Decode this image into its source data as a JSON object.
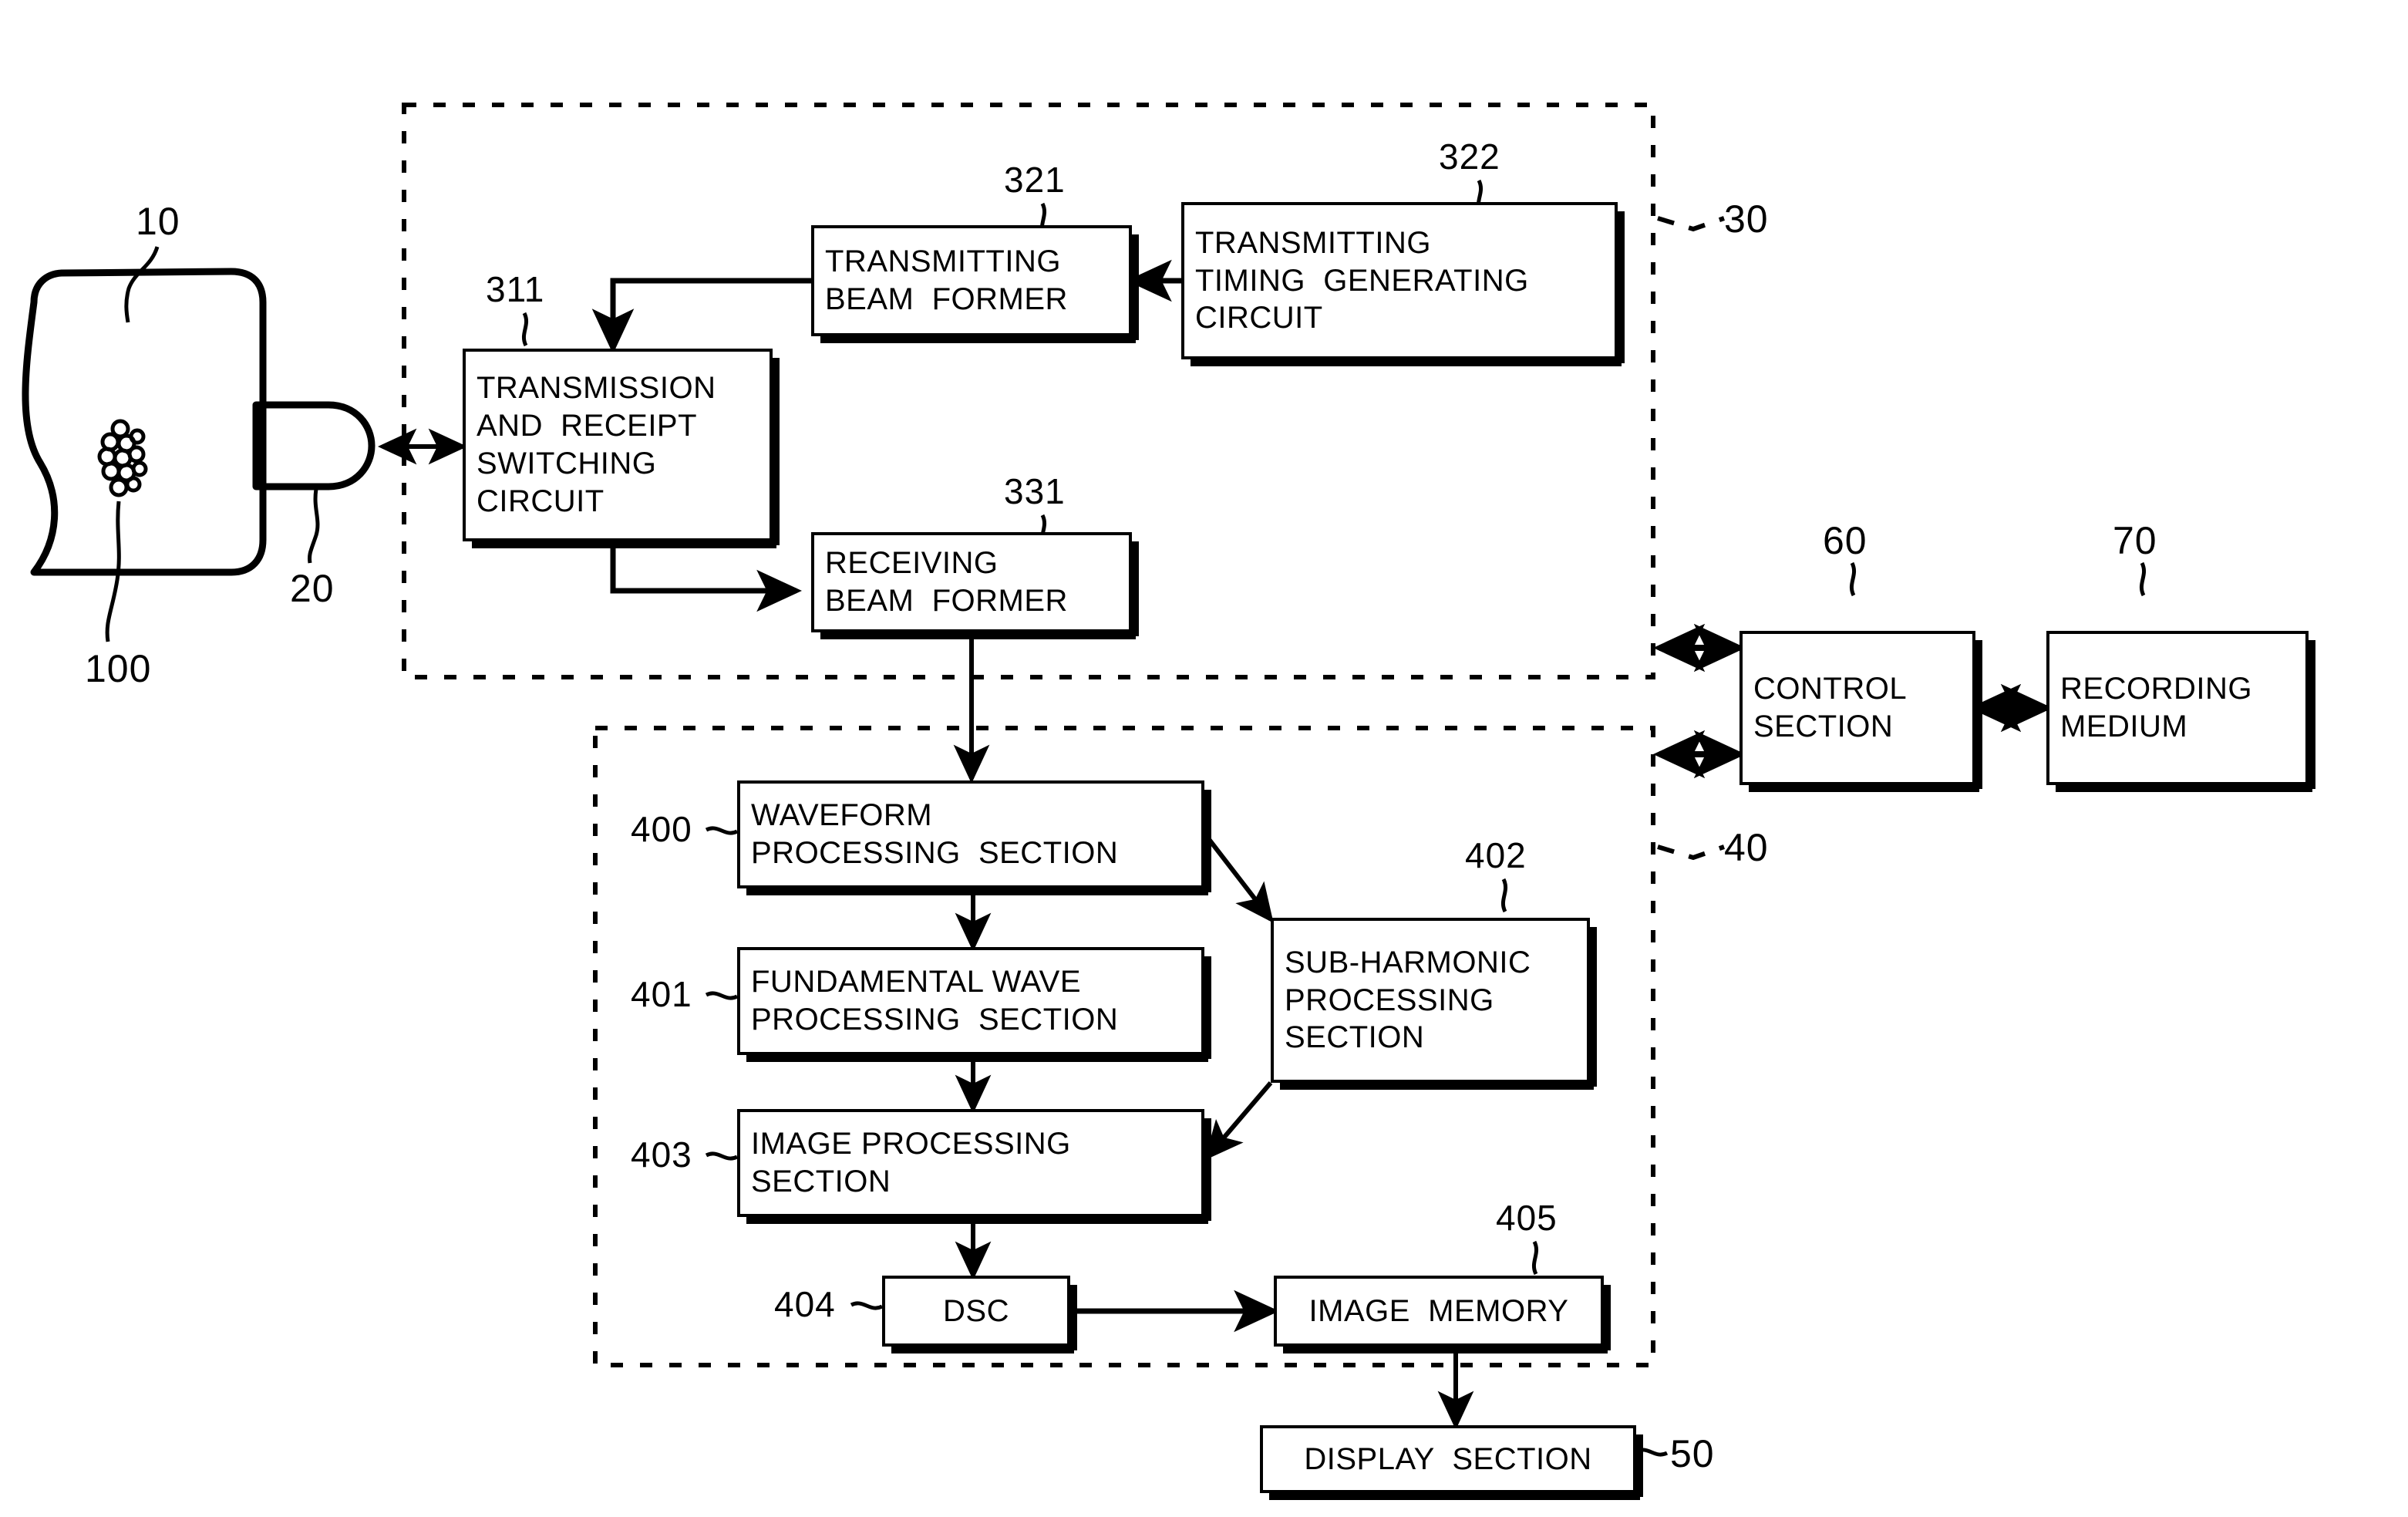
{
  "figure": {
    "type": "patent-block-diagram",
    "title": "Ultrasonic diagnostic apparatus block diagram"
  },
  "subject": {
    "body_ref": "10",
    "bubbles_ref": "100",
    "probe_ref": "20"
  },
  "transmit_receive_unit": {
    "ref": "30",
    "blocks": [
      {
        "ref": "311",
        "lines": [
          "TRANSMISSION",
          "AND  RECEIPT",
          "SWITCHING",
          "CIRCUIT"
        ]
      },
      {
        "ref": "321",
        "lines": [
          "TRANSMITTING",
          "BEAM  FORMER"
        ]
      },
      {
        "ref": "322",
        "lines": [
          "TRANSMITTING",
          "TIMING  GENERATING",
          "CIRCUIT"
        ]
      },
      {
        "ref": "331",
        "lines": [
          "RECEIVING",
          "BEAM  FORMER"
        ]
      }
    ]
  },
  "processing_unit": {
    "ref": "40",
    "blocks": [
      {
        "ref": "400",
        "lines": [
          "WAVEFORM",
          "PROCESSING  SECTION"
        ]
      },
      {
        "ref": "401",
        "lines": [
          "FUNDAMENTAL WAVE",
          "PROCESSING  SECTION"
        ]
      },
      {
        "ref": "402",
        "lines": [
          "SUB-HARMONIC",
          "PROCESSING",
          "SECTION"
        ]
      },
      {
        "ref": "403",
        "lines": [
          "IMAGE PROCESSING",
          "SECTION"
        ]
      },
      {
        "ref": "404",
        "lines": [
          "DSC"
        ]
      },
      {
        "ref": "405",
        "lines": [
          "IMAGE  MEMORY"
        ]
      }
    ]
  },
  "peripherals": {
    "control": {
      "ref": "60",
      "lines": [
        "CONTROL",
        "SECTION"
      ]
    },
    "recording": {
      "ref": "70",
      "lines": [
        "RECORDING",
        "MEDIUM"
      ]
    },
    "display": {
      "ref": "50",
      "lines": [
        "DISPLAY  SECTION"
      ]
    }
  },
  "colors": {
    "ink": "#000000",
    "paper": "#ffffff"
  }
}
